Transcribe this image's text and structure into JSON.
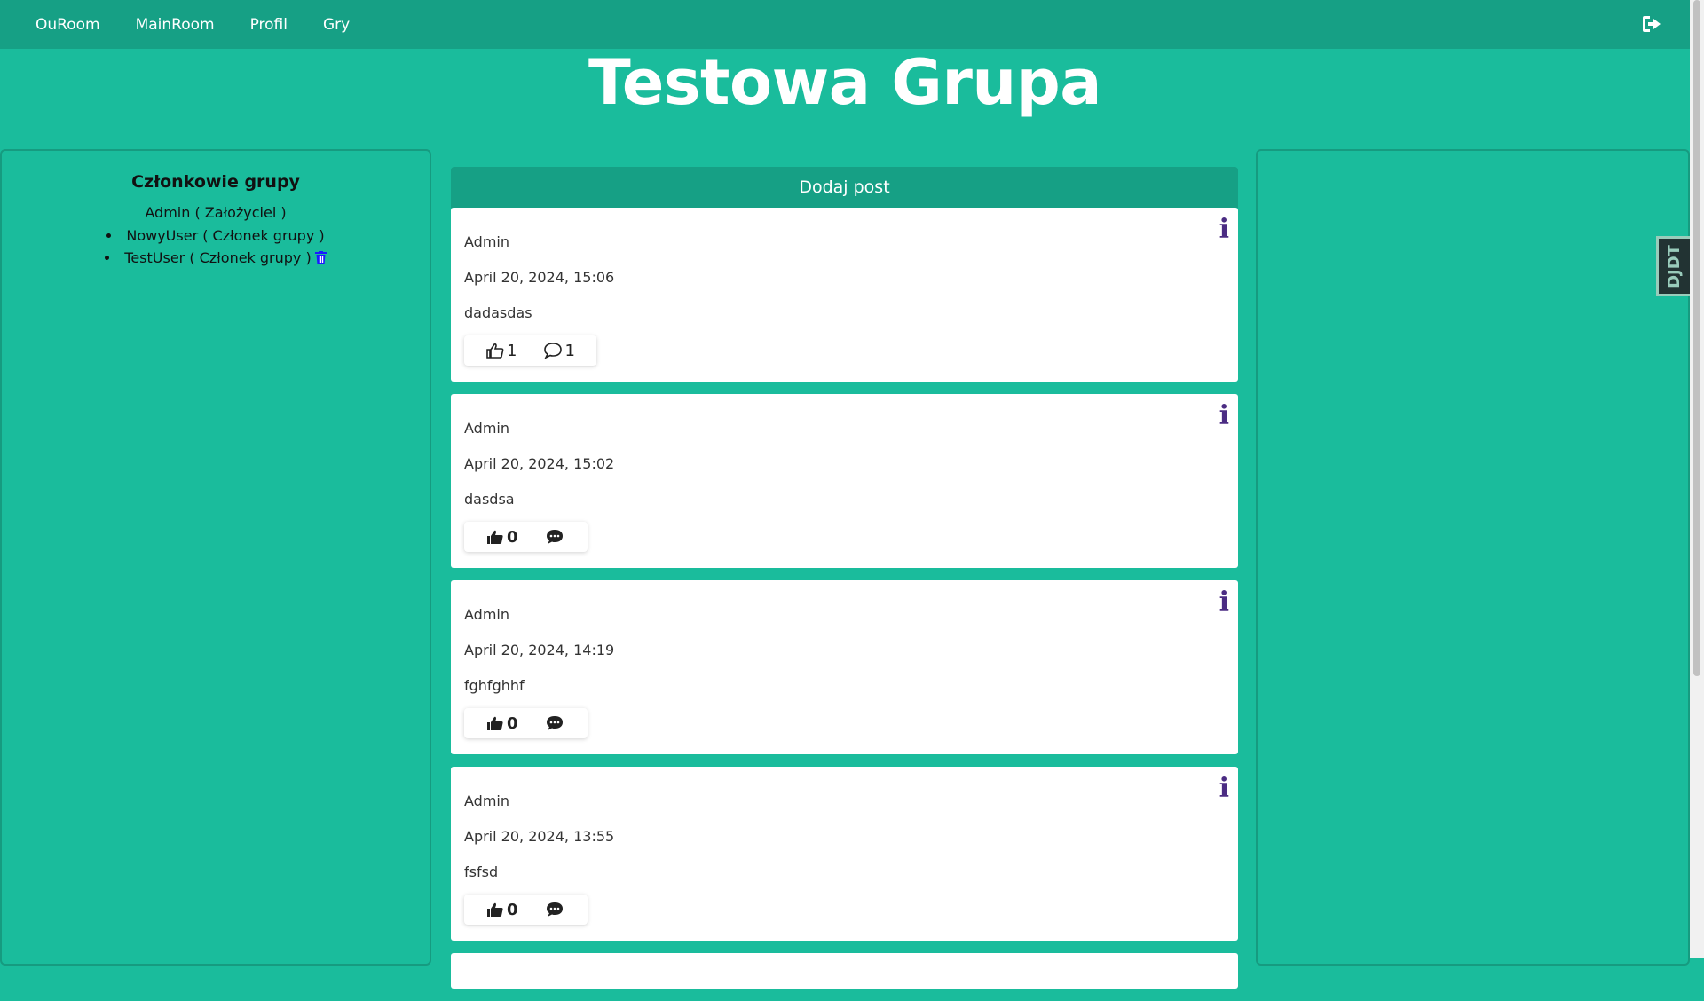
{
  "nav": {
    "links": [
      "OuRoom",
      "MainRoom",
      "Profil",
      "Gry"
    ],
    "logout_icon": "sign-out-icon"
  },
  "page": {
    "title": "Testowa Grupa"
  },
  "members": {
    "title": "Członkowie grupy",
    "founder": "Admin ( Założyciel )",
    "items": [
      "NowyUser ( Członek grupy )",
      "TestUser ( Członek grupy )"
    ],
    "delete_icon": "trash-icon",
    "delete_color": "#1a1aff"
  },
  "feed": {
    "add_post_label": "Dodaj post",
    "posts": [
      {
        "author": "Admin",
        "date": "April 20, 2024, 15:06",
        "content": "dadasdas",
        "likes": "1",
        "comments": "1"
      },
      {
        "author": "Admin",
        "date": "April 20, 2024, 15:02",
        "content": "dasdsa",
        "likes": "0",
        "comments": ""
      },
      {
        "author": "Admin",
        "date": "April 20, 2024, 14:19",
        "content": "fghfghhf",
        "likes": "0",
        "comments": ""
      },
      {
        "author": "Admin",
        "date": "April 20, 2024, 13:55",
        "content": "fsfsd",
        "likes": "0",
        "comments": ""
      }
    ]
  },
  "debug_toolbar": {
    "label": "DJDT"
  },
  "colors": {
    "background": "#1abc9c",
    "nav": "#16a085",
    "info": "#4b2c83"
  }
}
